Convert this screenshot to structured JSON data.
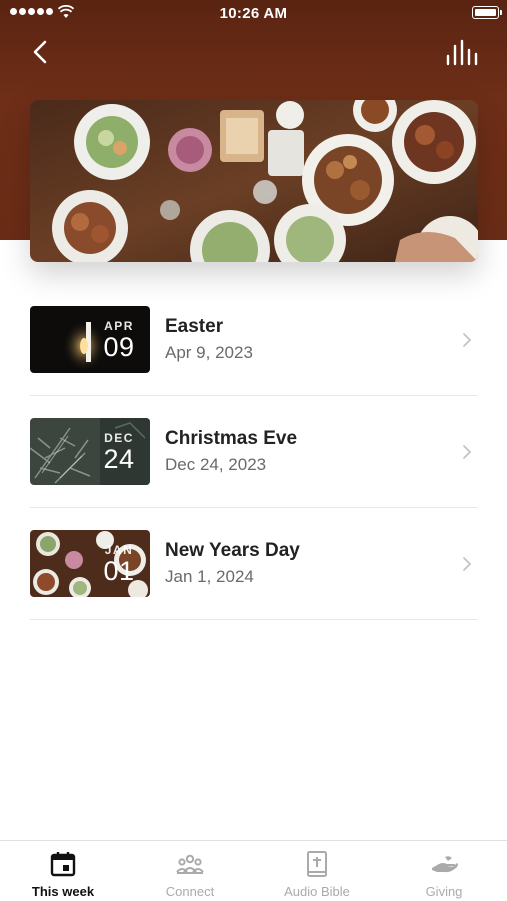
{
  "status_bar": {
    "time": "10:26 AM"
  },
  "header": {
    "back_icon": "chevron-left-icon",
    "listen_icon": "audio-bars-icon"
  },
  "hero": {
    "description": "holiday dinner table"
  },
  "events": [
    {
      "title": "Easter",
      "date": "Apr 9, 2023",
      "month": "APR",
      "day": "09",
      "thumb": "candle"
    },
    {
      "title": "Christmas Eve",
      "date": "Dec 24, 2023",
      "month": "DEC",
      "day": "24",
      "thumb": "pine"
    },
    {
      "title": "New Years Day",
      "date": "Jan 1, 2024",
      "month": "JAN",
      "day": "01",
      "thumb": "feast"
    }
  ],
  "tabs": [
    {
      "label": "This week",
      "icon": "calendar-icon",
      "active": true
    },
    {
      "label": "Connect",
      "icon": "people-icon",
      "active": false
    },
    {
      "label": "Audio Bible",
      "icon": "bible-icon",
      "active": false
    },
    {
      "label": "Giving",
      "icon": "giving-hand-icon",
      "active": false
    }
  ],
  "colors": {
    "header": "#6a2c16",
    "active_tab": "#111111",
    "inactive_tab": "#aaaaaa"
  }
}
